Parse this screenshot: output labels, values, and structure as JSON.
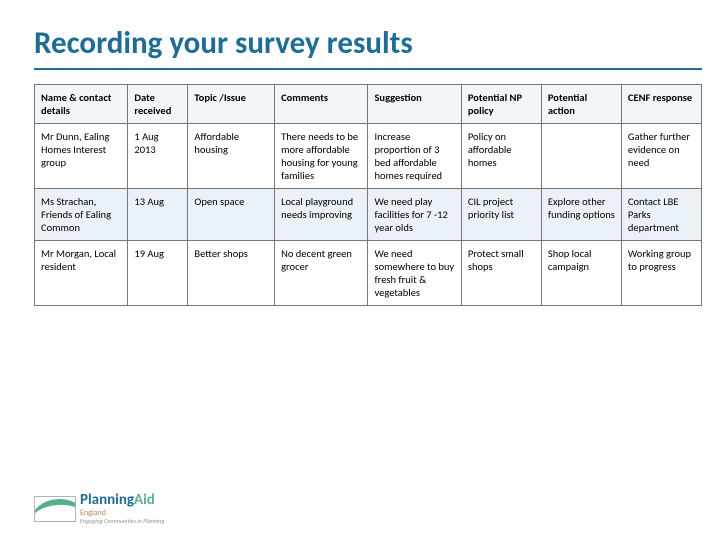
{
  "title": "Recording your survey results",
  "table": {
    "headers": [
      "Name & contact details",
      "Date received",
      "Topic /Issue",
      "Comments",
      "Suggestion",
      "Potential NP policy",
      "Potential action",
      "CENF response"
    ],
    "rows": [
      {
        "name": "Mr Dunn, Ealing Homes Interest group",
        "date": "1 Aug 2013",
        "topic": "Affordable housing",
        "comments": "There needs to be more affordable housing for young families",
        "suggestion": "Increase proportion of 3 bed affordable homes required",
        "policy": "Policy on affordable homes",
        "action": "",
        "response": "Gather further evidence on need"
      },
      {
        "name": "Ms Strachan, Friends of Ealing Common",
        "date": "13 Aug",
        "topic": "Open space",
        "comments": "Local playground needs improving",
        "suggestion": "We need play facilities for 7 -12 year olds",
        "policy": "CIL project priority list",
        "action": "Explore other funding options",
        "response": "Contact LBE Parks department"
      },
      {
        "name": "Mr Morgan, Local resident",
        "date": "19 Aug",
        "topic": "Better shops",
        "comments": "No decent green grocer",
        "suggestion": "We need somewhere to buy fresh fruit & vegetables",
        "policy": "Protect small shops",
        "action": "Shop local campaign",
        "response": "Working group to progress"
      }
    ]
  },
  "logo": {
    "word1": "Planning",
    "word2": "Aid",
    "sub": "England",
    "tagline": "Engaging Communities in Planning"
  }
}
